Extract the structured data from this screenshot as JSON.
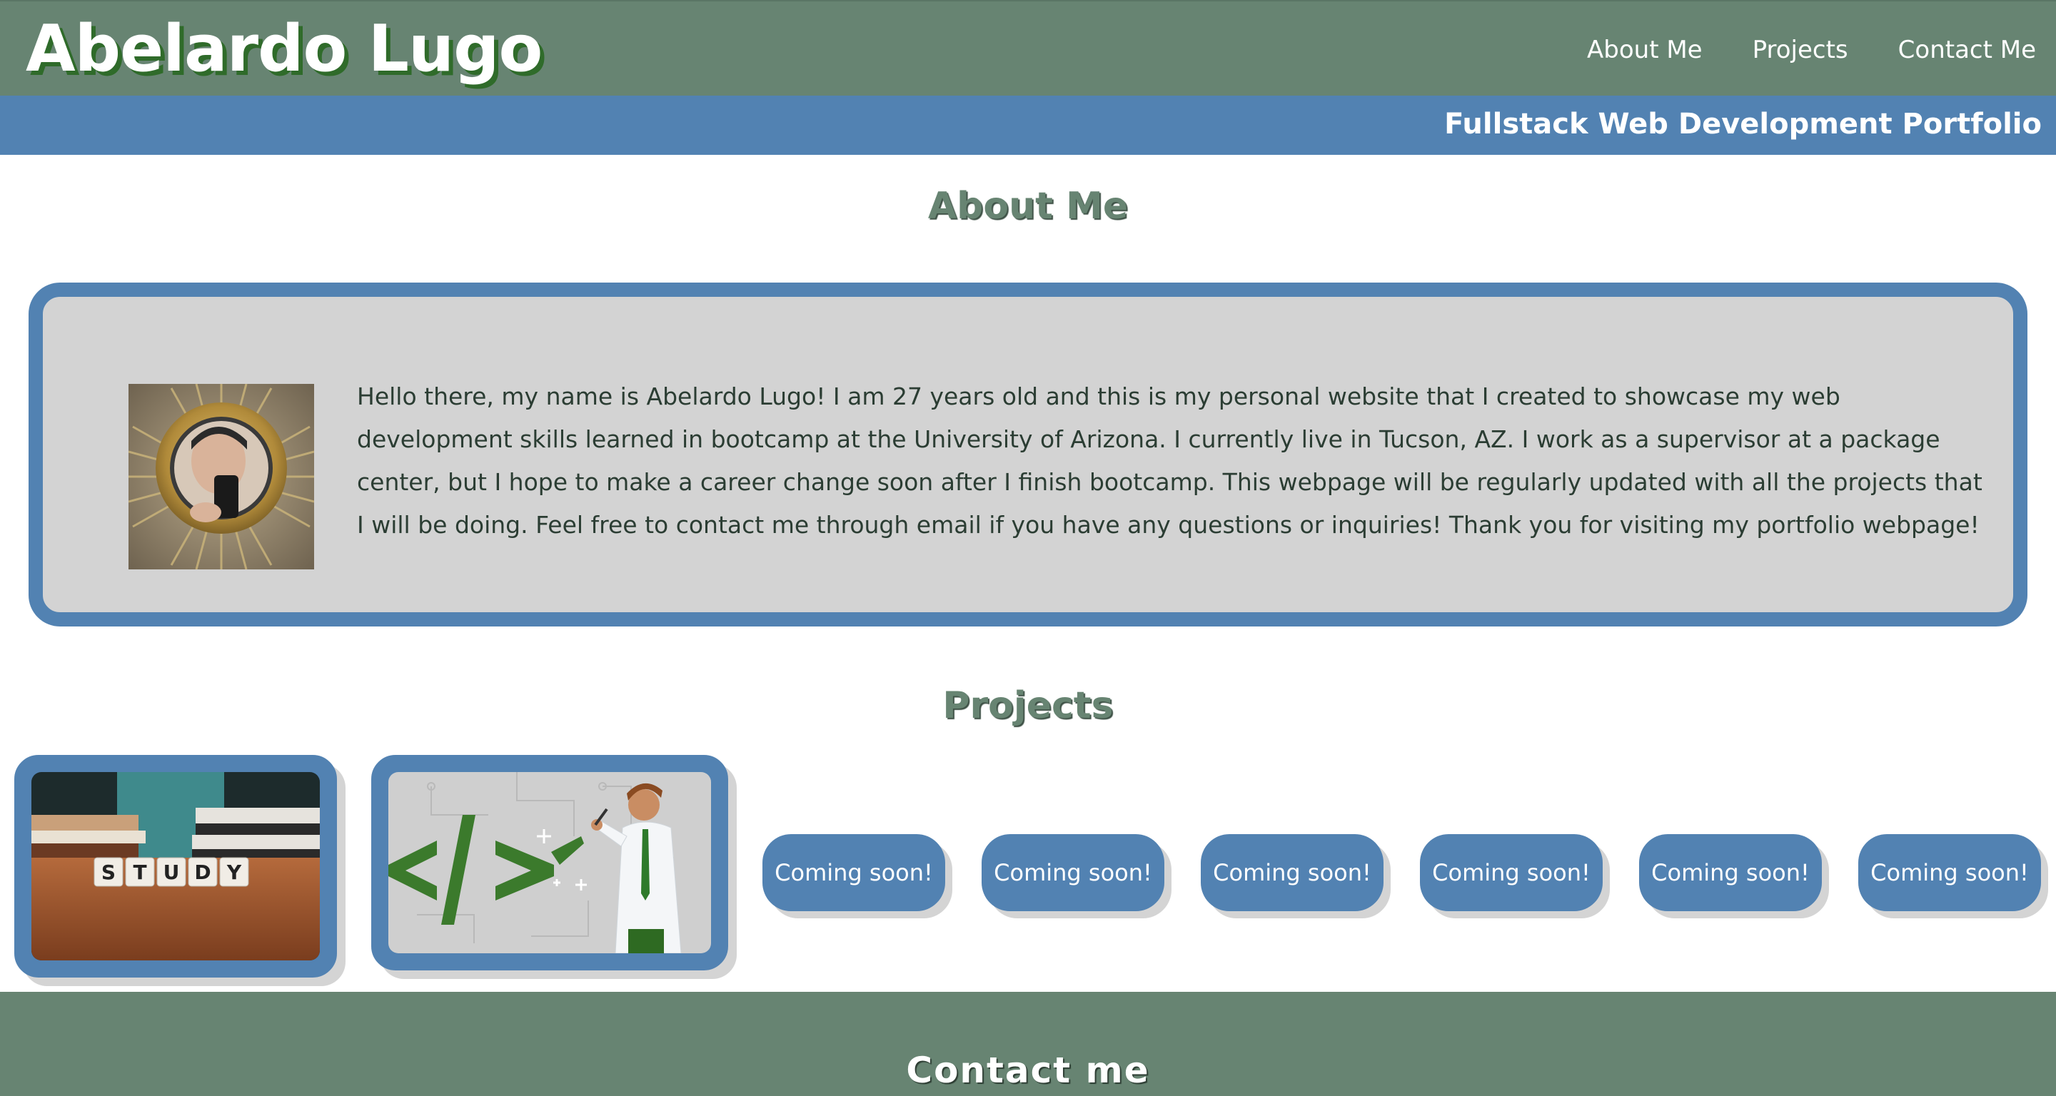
{
  "header": {
    "title": "Abelardo Lugo",
    "subtitle": "Fullstack Web Development Portfolio",
    "nav": [
      {
        "label": "About Me"
      },
      {
        "label": "Projects"
      },
      {
        "label": "Contact Me"
      }
    ]
  },
  "about": {
    "heading": "About Me",
    "text": "Hello there, my name is Abelardo Lugo! I am 27 years old and this is my personal website that I created to showcase my web development skills learned in bootcamp at the University of Arizona. I currently live in Tucson, AZ. I work as a supervisor at a package center, but I hope to make a career change soon after I finish bootcamp. This webpage will be regularly updated with all the projects that I will be doing. Feel free to contact me through email if you have any questions or inquiries! Thank you for visiting my portfolio webpage!",
    "photo_letters": ""
  },
  "projects": {
    "heading": "Projects",
    "cards": [
      {
        "image_text": "STUDY"
      },
      {
        "image_text": "</>"
      }
    ],
    "coming_soon": [
      {
        "label": "Coming soon!"
      },
      {
        "label": "Coming soon!"
      },
      {
        "label": "Coming soon!"
      },
      {
        "label": "Coming soon!"
      },
      {
        "label": "Coming soon!"
      },
      {
        "label": "Coming soon!"
      }
    ]
  },
  "footer": {
    "heading": "Contact me"
  },
  "colors": {
    "header_green": "#678472",
    "accent_blue": "#5282b2",
    "card_gray": "#d3d3d3",
    "title_shadow_green": "#2f6b2a"
  }
}
